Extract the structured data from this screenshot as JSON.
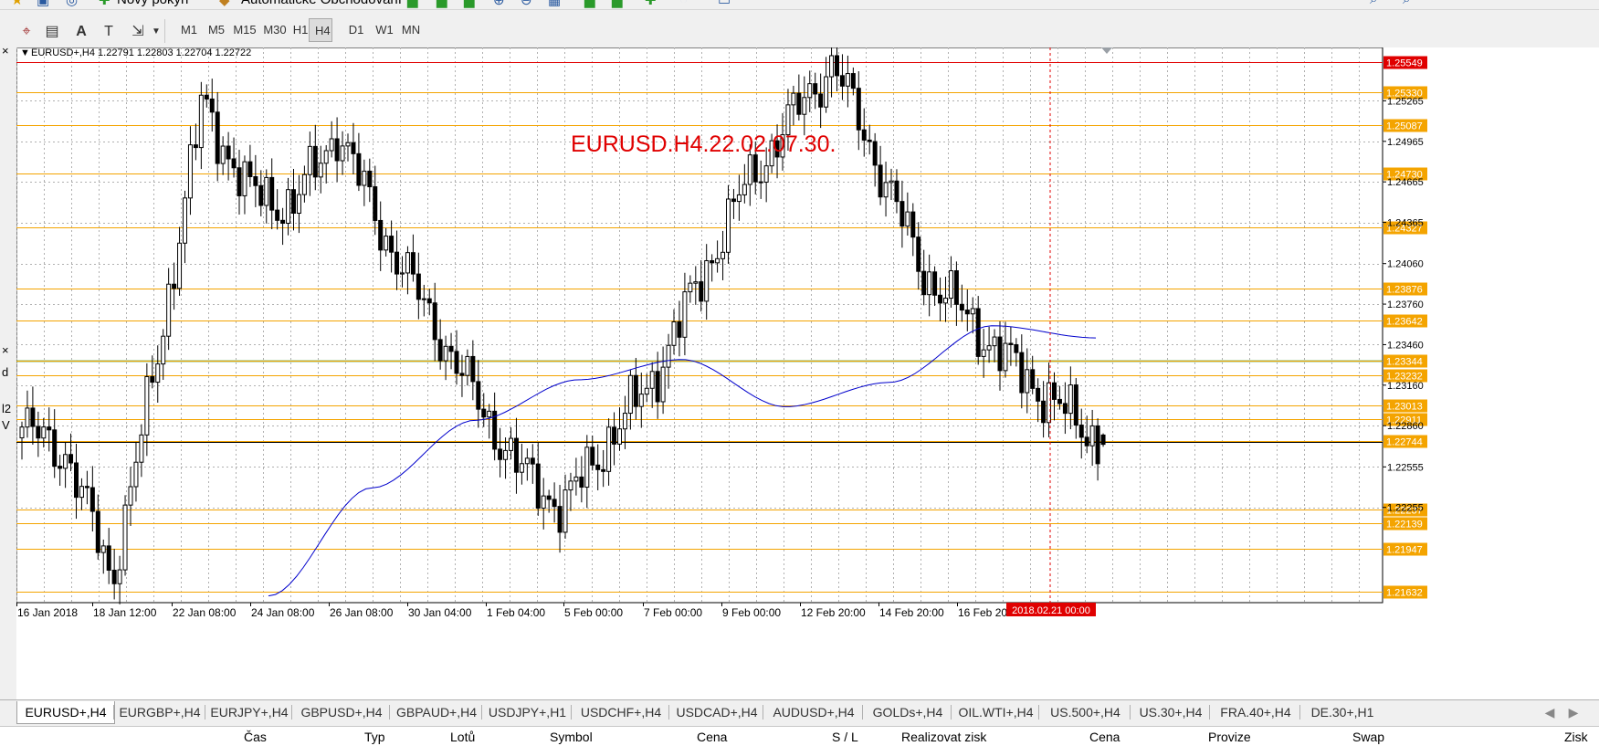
{
  "toolbar_top": {
    "new_order_label": "Nový pokyn",
    "auto_trading_label": "Automatické Obchodování"
  },
  "timeframes": [
    "M1",
    "M5",
    "M15",
    "M30",
    "H1",
    "H4",
    "D1",
    "W1",
    "MN"
  ],
  "active_timeframe": "H4",
  "chart": {
    "header": "EURUSD+,H4  1.22791 1.22803 1.22704 1.22722",
    "watermark": "EURUSD.H4.22.02.07.30.",
    "current_price": "1.22744",
    "date_marker": "2018.02.21 00:00",
    "colors": {
      "bull": "#ffffff",
      "bear": "#000000",
      "ma": "#0000cc",
      "level": "#f4a400",
      "resistance": "#e00000",
      "green_level": "#007a00",
      "watermark": "#e00000"
    }
  },
  "chart_data": {
    "type": "candlestick",
    "symbol": "EURUSD+",
    "timeframe": "H4",
    "ylim": [
      1.2155,
      1.2566
    ],
    "price_ticks": [
      "1.25265",
      "1.24965",
      "1.24665",
      "1.24365",
      "1.24060",
      "1.23760",
      "1.23460",
      "1.23160",
      "1.22860",
      "1.22555",
      "1.22255"
    ],
    "time_labels": [
      "16 Jan 2018",
      "18 Jan 12:00",
      "22 Jan 08:00",
      "24 Jan 08:00",
      "26 Jan 08:00",
      "30 Jan 04:00",
      "1 Feb 04:00",
      "5 Feb 00:00",
      "7 Feb 00:00",
      "9 Feb 00:00",
      "12 Feb 20:00",
      "14 Feb 20:00",
      "16 Feb 20:"
    ],
    "levels": [
      {
        "price": 1.25549,
        "label": "1.25549",
        "kind": "resistance"
      },
      {
        "price": 1.2533,
        "label": "1.25330",
        "kind": "orange"
      },
      {
        "price": 1.25087,
        "label": "1.25087",
        "kind": "orange"
      },
      {
        "price": 1.2473,
        "label": "1.24730",
        "kind": "orange"
      },
      {
        "price": 1.24327,
        "label": "1.24327",
        "kind": "orange"
      },
      {
        "price": 1.23876,
        "label": "1.23876",
        "kind": "orange"
      },
      {
        "price": 1.23642,
        "label": "1.23642",
        "kind": "orange"
      },
      {
        "price": 1.2334,
        "label": "",
        "kind": "green"
      },
      {
        "price": 1.23344,
        "label": "1.23344",
        "kind": "orange"
      },
      {
        "price": 1.23232,
        "label": "1.23232",
        "kind": "orange"
      },
      {
        "price": 1.23013,
        "label": "1.23013",
        "kind": "orange"
      },
      {
        "price": 1.22911,
        "label": "1.22911",
        "kind": "orange"
      },
      {
        "price": 1.22744,
        "label": "1.22744",
        "kind": "orange"
      },
      {
        "price": 1.22237,
        "label": "1.22237",
        "kind": "orange"
      },
      {
        "price": 1.22139,
        "label": "1.22139",
        "kind": "orange"
      },
      {
        "price": 1.21947,
        "label": "1.21947",
        "kind": "orange"
      },
      {
        "price": 1.21632,
        "label": "1.21632",
        "kind": "orange"
      }
    ],
    "last_bar": {
      "open": 1.22791,
      "high": 1.22803,
      "low": 1.22704,
      "close": 1.22722
    },
    "key_prices": [
      1.2285,
      1.2265,
      1.2172,
      1.2335,
      1.2525,
      1.246,
      1.2448,
      1.2505,
      1.243,
      1.237,
      1.231,
      1.2255,
      1.2225,
      1.2275,
      1.232,
      1.239,
      1.246,
      1.251,
      1.2555,
      1.248,
      1.24,
      1.2365,
      1.233,
      1.23,
      1.2272
    ],
    "ma_prices": [
      1.216,
      1.224,
      1.229,
      1.232,
      1.2335,
      1.23,
      1.2318,
      1.236,
      1.2351
    ]
  },
  "symbol_tabs": [
    "EURUSD+,H4",
    "EURGBP+,H4",
    "EURJPY+,H4",
    "GBPUSD+,H4",
    "GBPAUD+,H4",
    "USDJPY+,H1",
    "USDCHF+,H4",
    "USDCAD+,H4",
    "AUDUSD+,H4",
    "GOLDs+,H4",
    "OIL.WTI+,H4",
    "US.500+,H4",
    "US.30+,H4",
    "FRA.40+,H4",
    "DE.30+,H1"
  ],
  "active_tab": "EURUSD+,H4",
  "terminal_columns": [
    "Čas",
    "Typ",
    "Lotů",
    "Symbol",
    "Cena",
    "S / L",
    "Realizovat zisk",
    "Cena",
    "Provize",
    "Swap",
    "Zisk"
  ],
  "left_edge_glyphs": [
    "×",
    "×",
    "d",
    "l2",
    "V"
  ]
}
